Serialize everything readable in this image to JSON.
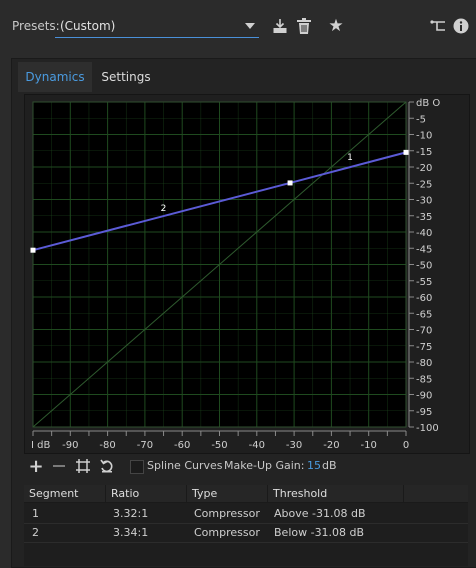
{
  "header": {
    "presets_label": "Presets:",
    "presets_value": "(Custom)",
    "icons": [
      "save-preset-icon",
      "delete-preset-icon",
      "favorite-star-icon",
      "routing-icon",
      "info-icon"
    ]
  },
  "tabs": [
    {
      "label": "Dynamics",
      "active": true
    },
    {
      "label": "Settings",
      "active": false
    }
  ],
  "graph": {
    "x_tick_labels": [
      "dB",
      "-90",
      "-80",
      "-70",
      "-60",
      "-50",
      "-40",
      "-30",
      "-20",
      "-10",
      "0"
    ],
    "x_first_prefix": "I",
    "y_tick_labels": [
      "dB",
      "-5",
      "-10",
      "-15",
      "-20",
      "-25",
      "-30",
      "-35",
      "-40",
      "-45",
      "-50",
      "-55",
      "-60",
      "-65",
      "-70",
      "-75",
      "-80",
      "-85",
      "-90",
      "-95",
      "-100"
    ],
    "y_first_suffix": "O",
    "curve_points": [
      {
        "input_db": -100,
        "output_db": -45.6
      },
      {
        "input_db": -31.08,
        "output_db": -24.9
      },
      {
        "input_db": 0,
        "output_db": -15.5
      }
    ],
    "segment_labels": [
      {
        "label": "1",
        "input_db": -15,
        "output_db": -17.8
      },
      {
        "label": "2",
        "input_db": -65,
        "output_db": -33.5
      }
    ],
    "colors": {
      "curve": "#5b5bd6",
      "grid": "#1f4a1f",
      "diagonal": "#2e5a2e",
      "background": "#000000"
    }
  },
  "toolbar": {
    "icons": [
      "add-point-icon",
      "remove-point-icon",
      "fit-icon",
      "reset-icon"
    ],
    "spline_label": "Spline Curves",
    "spline_checked": false,
    "makeup_label": "Make-Up Gain:",
    "makeup_value": "15",
    "makeup_unit": "dB"
  },
  "table": {
    "headers": [
      "Segment",
      "Ratio",
      "Type",
      "Threshold"
    ],
    "rows": [
      {
        "segment": "1",
        "ratio": "3.32:1",
        "type": "Compressor",
        "threshold": "Above -31.08 dB"
      },
      {
        "segment": "2",
        "ratio": "3.34:1",
        "type": "Compressor",
        "threshold": "Below -31.08 dB"
      }
    ]
  }
}
